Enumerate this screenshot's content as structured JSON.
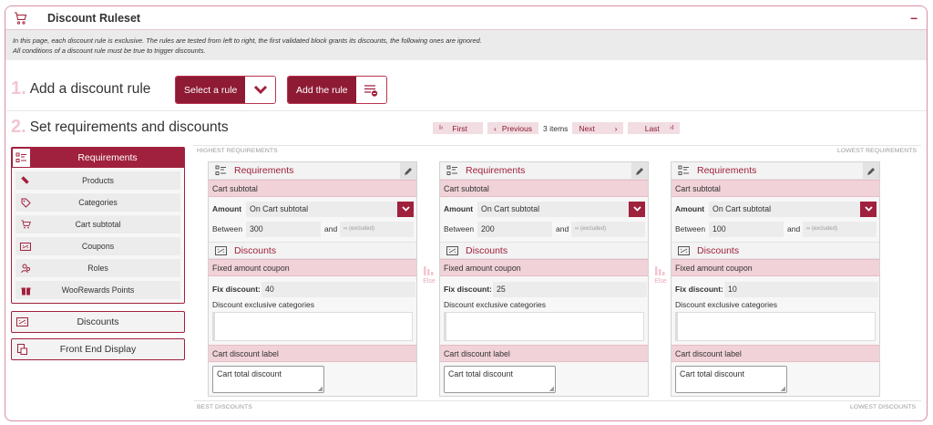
{
  "header": {
    "title": "Discount Ruleset",
    "collapse_label": "–"
  },
  "intro": {
    "line1": "In this page, each discount rule is exclusive. The rules are tested from left to right, the first validated block grants its discounts, the following ones are ignored.",
    "line2": "All conditions of a discount rule must be true to trigger discounts."
  },
  "step1": {
    "num": "1.",
    "label": "Add a discount rule",
    "select_label": "Select a rule",
    "add_label": "Add the rule"
  },
  "step2": {
    "num": "2.",
    "label": "Set requirements and discounts"
  },
  "pager": {
    "first": "First",
    "previous": "Previous",
    "count": "3 items",
    "next": "Next",
    "last": "Last",
    "first_icon": "I‹",
    "prev_icon": "‹",
    "next_icon": "›",
    "last_icon": "›I"
  },
  "sidebar": {
    "requirements_label": "Requirements",
    "items": [
      {
        "label": "Products",
        "icon": "product-icon"
      },
      {
        "label": "Categories",
        "icon": "tag-icon"
      },
      {
        "label": "Cart subtotal",
        "icon": "cart-icon"
      },
      {
        "label": "Coupons",
        "icon": "coupon-icon"
      },
      {
        "label": "Roles",
        "icon": "users-icon"
      },
      {
        "label": "WooRewards Points",
        "icon": "gift-icon"
      }
    ],
    "discounts_label": "Discounts",
    "frontend_label": "Front End Display"
  },
  "captions": {
    "highest": "HIGHEST REQUIREMENTS",
    "lowest": "LOWEST REQUIREMENTS",
    "best": "BEST DISCOUNTS",
    "lowest_disc": "LOWEST DISCOUNTS",
    "else": "Else"
  },
  "cards": [
    {
      "req_title": "Requirements",
      "cart_subtotal": "Cart subtotal",
      "amount_label": "Amount",
      "amount_value": "On Cart subtotal",
      "between_label": "Between",
      "between_value": "300",
      "and_label": "and",
      "and_placeholder": "∞ (excluded)",
      "disc_title": "Discounts",
      "fixed_label": "Fixed amount coupon",
      "fix_discount_label": "Fix discount:",
      "fix_discount_value": "40",
      "exclusive_label": "Discount exclusive categories",
      "cart_label_header": "Cart discount label",
      "cart_label_value": "Cart total discount"
    },
    {
      "req_title": "Requirements",
      "cart_subtotal": "Cart subtotal",
      "amount_label": "Amount",
      "amount_value": "On Cart subtotal",
      "between_label": "Between",
      "between_value": "200",
      "and_label": "and",
      "and_placeholder": "∞ (excluded)",
      "disc_title": "Discounts",
      "fixed_label": "Fixed amount coupon",
      "fix_discount_label": "Fix discount:",
      "fix_discount_value": "25",
      "exclusive_label": "Discount exclusive categories",
      "cart_label_header": "Cart discount label",
      "cart_label_value": "Cart total discount"
    },
    {
      "req_title": "Requirements",
      "cart_subtotal": "Cart subtotal",
      "amount_label": "Amount",
      "amount_value": "On Cart subtotal",
      "between_label": "Between",
      "between_value": "100",
      "and_label": "and",
      "and_placeholder": "∞ (excluded)",
      "disc_title": "Discounts",
      "fixed_label": "Fixed amount coupon",
      "fix_discount_label": "Fix discount:",
      "fix_discount_value": "10",
      "exclusive_label": "Discount exclusive categories",
      "cart_label_header": "Cart discount label",
      "cart_label_value": "Cart total discount"
    }
  ],
  "colors": {
    "accent": "#a0213d",
    "accent_dark": "#8e1a34",
    "pink_band": "#f1d2d9",
    "step_number": "#f2c6d0"
  }
}
